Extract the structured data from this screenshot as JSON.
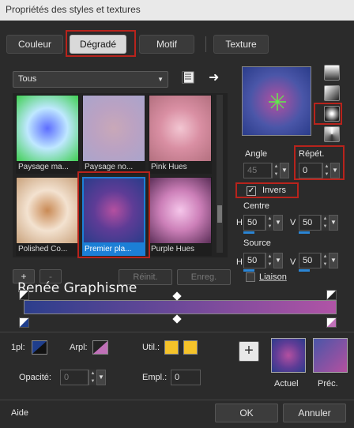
{
  "window": {
    "title": "Propriétés des styles et textures"
  },
  "tabs": [
    {
      "label": "Couleur"
    },
    {
      "label": "Dégradé"
    },
    {
      "label": "Motif"
    },
    {
      "label": "Texture"
    }
  ],
  "category": {
    "selected": "Tous"
  },
  "gradients": [
    {
      "label": "Paysage ma...",
      "colors": [
        "#5d6dff",
        "#bfe8ff",
        "#3fcf52"
      ]
    },
    {
      "label": "Paysage no...",
      "colors": [
        "#c9a8b8",
        "#bba2c2",
        "#a9a4cc"
      ]
    },
    {
      "label": "Pink Hues",
      "colors": [
        "#f2c6d2",
        "#d98fa3",
        "#b3707f"
      ]
    },
    {
      "label": "Polished Co...",
      "colors": [
        "#c98a55",
        "#f3e2d0",
        "#c9a27c"
      ]
    },
    {
      "label": "Premier pla...",
      "colors": [
        "#b450a0",
        "#5e3c96",
        "#2a3c8a"
      ]
    },
    {
      "label": "Purple Hues",
      "colors": [
        "#f5c6ea",
        "#cc7fb8",
        "#5a2e57"
      ]
    }
  ],
  "selected_gradient": "Premier pla...",
  "preview": {
    "colors": [
      "#b450a0",
      "#4a56a8",
      "#2a3c8a"
    ]
  },
  "angle": {
    "label": "Angle",
    "value": "45"
  },
  "repeat": {
    "label": "Répét.",
    "value": "0"
  },
  "invert": {
    "label": "Invers",
    "checked": true
  },
  "centre": {
    "label": "Centre",
    "h_label": "H",
    "h_value": "50",
    "v_label": "V",
    "v_value": "50"
  },
  "source": {
    "label": "Source",
    "h_label": "H",
    "h_value": "50",
    "v_label": "V",
    "v_value": "50"
  },
  "link": {
    "label": "Liaison"
  },
  "list_buttons": {
    "add": "+",
    "remove": "-",
    "reset": "Réinit.",
    "save": "Enreg."
  },
  "watermark": "Renée Graphisme",
  "gradient_bar": {
    "from": "#2c3e8c",
    "to": "#b054a6"
  },
  "stops": {
    "first_label": "1pl:",
    "bg_label": "Arpl:",
    "user_label": "Util.:",
    "opacity_label": "Opacité:",
    "opacity_value": "0",
    "location_label": "Empl.:",
    "location_value": "0",
    "first_color": "#1f3e8c",
    "bg_color": "#c070b8",
    "user_color_1": "#f5c32a",
    "user_color_2": "#f5c32a"
  },
  "current": {
    "label": "Actuel",
    "colors": [
      "#b450a0",
      "#5e3c96",
      "#2a3c8a"
    ]
  },
  "previous": {
    "label": "Préc.",
    "colors": [
      "#b450a0",
      "#4a56a8"
    ]
  },
  "footer": {
    "help": "Aide",
    "ok": "OK",
    "cancel": "Annuler"
  }
}
